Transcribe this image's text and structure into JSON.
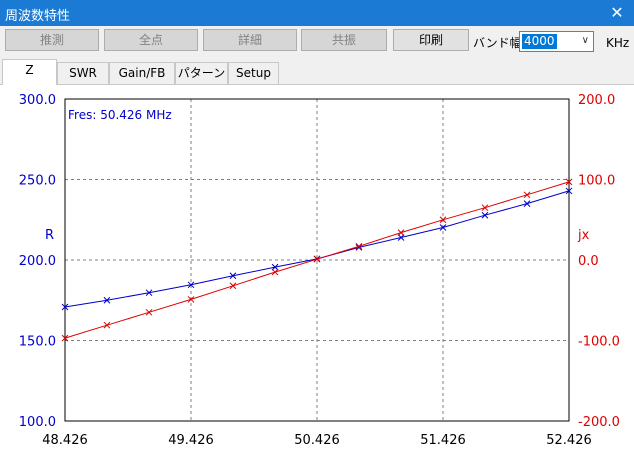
{
  "window": {
    "title": "周波数特性",
    "close_glyph": "✕"
  },
  "toolbar": {
    "buttons": [
      "推測",
      "全点",
      "詳細",
      "共振"
    ],
    "print_label": "印刷",
    "band_label": "バンド幅",
    "band_value": "4000",
    "band_unit": "KHz"
  },
  "tabs": [
    "Z",
    "SWR",
    "Gain/FB",
    "パターン",
    "Setup"
  ],
  "active_tab": "Z",
  "chart_data": {
    "type": "line",
    "annotation": "Fres: 50.426 MHz",
    "left_axis_label": "R",
    "right_axis_label": "jx",
    "x_ticks": [
      "48.426",
      "49.426",
      "50.426",
      "51.426",
      "52.426"
    ],
    "y_left_ticks": [
      "300.0",
      "250.0",
      "200.0",
      "150.0",
      "100.0"
    ],
    "y_right_ticks": [
      "200.0",
      "100.0",
      "0.0",
      "-100.0",
      "-200.0"
    ],
    "xlim": [
      48.426,
      52.426
    ],
    "ylim_left": [
      100,
      300
    ],
    "ylim_right": [
      -200,
      200
    ],
    "colors": {
      "r": "#0000cc",
      "jx": "#dd0000",
      "grid": "#808080"
    },
    "series": [
      {
        "axis": "left",
        "x": [
          48.426,
          48.759,
          49.093,
          49.426,
          49.759,
          50.093,
          50.426,
          50.759,
          51.093,
          51.426,
          51.759,
          52.093,
          52.426
        ],
        "values": [
          170.8,
          175.0,
          179.7,
          184.6,
          190.2,
          195.6,
          200.7,
          207.8,
          214.0,
          220.2,
          227.8,
          235.0,
          242.9
        ]
      },
      {
        "axis": "right",
        "x": [
          48.426,
          48.759,
          49.093,
          49.426,
          49.759,
          50.093,
          50.426,
          50.759,
          51.093,
          51.426,
          51.759,
          52.093,
          52.426
        ],
        "values": [
          -97,
          -81,
          -65,
          -49,
          -32,
          -15,
          1,
          17,
          34,
          50,
          65,
          81,
          97
        ]
      }
    ]
  }
}
